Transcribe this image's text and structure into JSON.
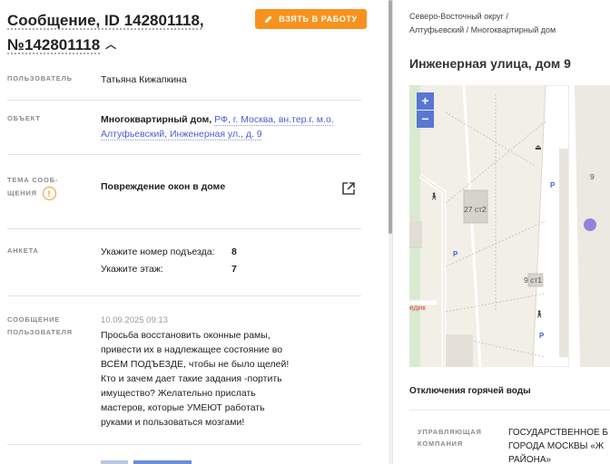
{
  "message": {
    "title_line1": "Сообщение, ID 142801118,",
    "title_line2": "№142801118",
    "take_button": "ВЗЯТЬ В РАБОТУ"
  },
  "fields": {
    "user_label": "ПОЛЬЗОВАТЕЛЬ",
    "user_value": "Татьяна Кижапкина",
    "object_label": "ОБЪЕКТ",
    "object_bold": "Многоквартирный дом,",
    "object_link": "РФ, г. Москва, вн.тер.г. м.о. Алтуфьевский, Инженерная ул., д. 9",
    "topic_label_1": "ТЕМА СООБ-",
    "topic_label_2": "ЩЕНИЯ",
    "topic_value": "Повреждение окон в доме",
    "form_label": "АНКЕТА",
    "form_items": [
      {
        "key": "Укажите номер подъезда:",
        "value": "8"
      },
      {
        "key": "Укажите этаж:",
        "value": "7"
      }
    ],
    "user_message_label_1": "СООБЩЕНИЕ",
    "user_message_label_2": "ПОЛЬЗОВАТЕЛЯ",
    "user_message_date": "10.09.2025 09:13",
    "user_message_lines": [
      "Просьба восстановить оконные рамы,",
      "привести их в надлежащее состояние во",
      "ВСЁМ ПОДЪЕЗДЕ, чтобы не было щелей!",
      "Кто и зачем дает такие задания -портить",
      "имущество? Желательно прислать",
      "мастеров, которые УМЕЮТ работать",
      "руками и пользоваться мозгами!"
    ]
  },
  "right": {
    "breadcrumb_line1": "Северо-Восточный округ /",
    "breadcrumb_line2": "Алтуфьевский / Многоквартирный дом",
    "address": "Инженерная улица, дом 9",
    "map": {
      "zoom_in": "+",
      "zoom_out": "−",
      "label_27": "27 ст2",
      "label_9st1": "9 ст1",
      "label_9": "9",
      "label_red": "едик",
      "poi_p": "P"
    },
    "section_title": "Отключения горячей воды",
    "manager_label_1": "УПРАВЛЯЮЩАЯ",
    "manager_label_2": "КОМПАНИЯ",
    "manager_value_lines": [
      "ГОСУДАРСТВЕННОЕ Б",
      "ГОРОДА МОСКВЫ «Ж",
      "РАЙОНА»"
    ]
  },
  "colors": {
    "accent_orange": "#f7921e",
    "link_blue": "#4a5ed6",
    "map_zoom": "#5a76d4",
    "marker": "#8f83e0"
  }
}
